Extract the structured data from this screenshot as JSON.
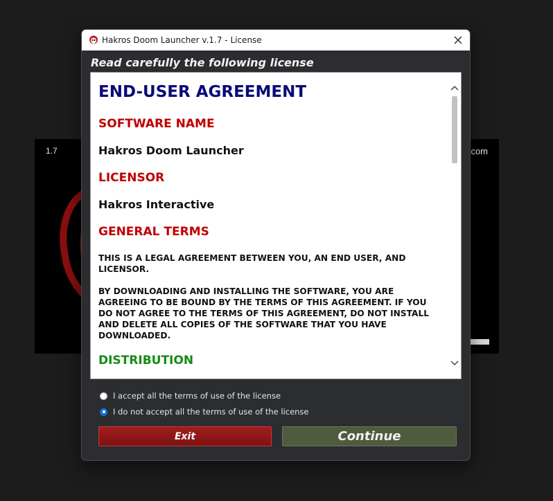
{
  "background": {
    "version": "1.7",
    "site_suffix": ".com"
  },
  "dialog": {
    "title": "Hakros Doom Launcher v.1.7 - License",
    "heading": "Read carefully the following license"
  },
  "license": {
    "title": "END-USER AGREEMENT",
    "software_name_heading": "SOFTWARE NAME",
    "software_name": "Hakros Doom Launcher",
    "licensor_heading": "LICENSOR",
    "licensor": "Hakros Interactive",
    "general_terms_heading": "GENERAL TERMS",
    "paragraph_1": "THIS IS A LEGAL AGREEMENT BETWEEN YOU, AN END USER, AND LICENSOR.",
    "paragraph_2": "BY DOWNLOADING AND INSTALLING THE SOFTWARE, YOU ARE AGREEING TO BE BOUND BY THE TERMS OF THIS AGREEMENT. IF YOU DO NOT AGREE TO THE TERMS OF THIS AGREEMENT, DO NOT INSTALL AND DELETE ALL COPIES OF THE SOFTWARE THAT YOU HAVE DOWNLOADED.",
    "distribution_heading": "DISTRIBUTION"
  },
  "options": {
    "accept_label": "I accept all the terms of use of the license",
    "decline_label": "I do not accept all the terms of use of the license",
    "selected": "decline"
  },
  "buttons": {
    "exit": "Exit",
    "continue": "Continue"
  },
  "colors": {
    "heading_blue": "#0a0a78",
    "section_red": "#c00000",
    "section_green": "#158a15",
    "exit_red": "#8f1717",
    "continue_olive": "#4f5b3f"
  },
  "icons": {
    "app": "doom-skull-icon",
    "close": "close-icon",
    "scroll_up": "chevron-up-icon",
    "scroll_down": "chevron-down-icon"
  }
}
